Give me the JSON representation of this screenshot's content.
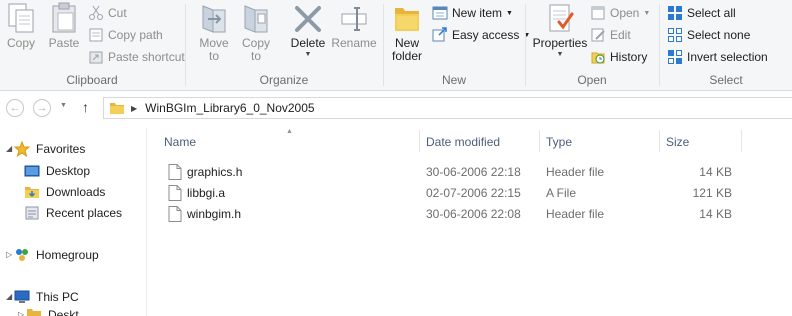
{
  "ribbon": {
    "clipboard": {
      "label": "Clipboard",
      "copy": "Copy",
      "paste": "Paste",
      "cut": "Cut",
      "copy_path": "Copy path",
      "paste_shortcut": "Paste shortcut"
    },
    "organize": {
      "label": "Organize",
      "move_to": [
        "Move",
        "to"
      ],
      "copy_to": [
        "Copy",
        "to"
      ],
      "delete": "Delete",
      "rename": "Rename"
    },
    "new": {
      "label": "New",
      "new_folder": [
        "New",
        "folder"
      ],
      "new_item": "New item",
      "easy_access": "Easy access"
    },
    "open": {
      "label": "Open",
      "properties": "Properties",
      "open": "Open",
      "edit": "Edit",
      "history": "History"
    },
    "select": {
      "label": "Select",
      "select_all": "Select all",
      "select_none": "Select none",
      "invert_selection": "Invert selection"
    }
  },
  "address": {
    "path": "WinBGIm_Library6_0_Nov2005"
  },
  "nav_pane": {
    "favorites": "Favorites",
    "desktop": "Desktop",
    "downloads": "Downloads",
    "recent_places": "Recent places",
    "homegroup": "Homegroup",
    "this_pc": "This PC",
    "next_partial": "Deskt"
  },
  "columns": {
    "name": "Name",
    "date_modified": "Date modified",
    "type": "Type",
    "size": "Size"
  },
  "files": [
    {
      "name": "graphics.h",
      "date": "30-06-2006 22:18",
      "type": "Header file",
      "size": "14 KB"
    },
    {
      "name": "libbgi.a",
      "date": "02-07-2006 22:15",
      "type": "A File",
      "size": "121 KB"
    },
    {
      "name": "winbgim.h",
      "date": "30-06-2006 22:08",
      "type": "Header file",
      "size": "14 KB"
    }
  ],
  "colors": {
    "ribbon_bg": "#f5f6f7",
    "header_text": "#4c607a",
    "folder_yellow": "#f3cf58",
    "accent_blue": "#2b79d0"
  }
}
